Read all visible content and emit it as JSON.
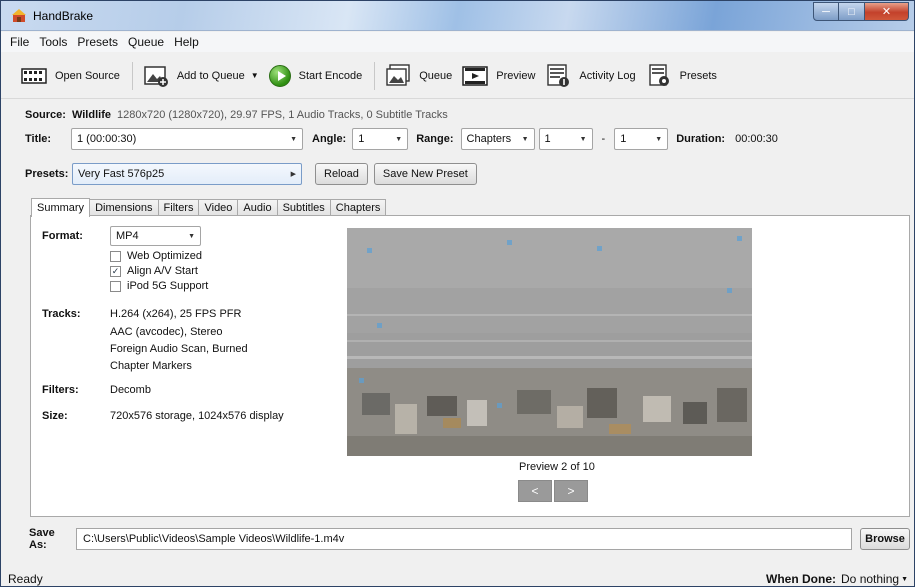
{
  "window": {
    "title": "HandBrake"
  },
  "menu": [
    "File",
    "Tools",
    "Presets",
    "Queue",
    "Help"
  ],
  "toolbar": {
    "open_source": "Open Source",
    "add_to_queue": "Add to Queue",
    "start_encode": "Start Encode",
    "queue": "Queue",
    "preview": "Preview",
    "activity_log": "Activity Log",
    "presets": "Presets"
  },
  "source": {
    "label": "Source:",
    "name": "Wildlife",
    "info": "1280x720 (1280x720), 29.97 FPS, 1 Audio Tracks, 0 Subtitle Tracks"
  },
  "title_row": {
    "title_label": "Title:",
    "title_value": "1 (00:00:30)",
    "angle_label": "Angle:",
    "angle_value": "1",
    "range_label": "Range:",
    "range_mode": "Chapters",
    "range_start": "1",
    "range_dash": "-",
    "range_end": "1",
    "duration_label": "Duration:",
    "duration_value": "00:00:30"
  },
  "presets_row": {
    "label": "Presets:",
    "value": "Very Fast 576p25",
    "reload": "Reload",
    "save_new": "Save New Preset"
  },
  "tabs": [
    "Summary",
    "Dimensions",
    "Filters",
    "Video",
    "Audio",
    "Subtitles",
    "Chapters"
  ],
  "summary": {
    "format_label": "Format:",
    "format_value": "MP4",
    "web_optimized": "Web Optimized",
    "align_av": "Align A/V Start",
    "ipod": "iPod 5G Support",
    "tracks_label": "Tracks:",
    "tracks": [
      "H.264 (x264), 25 FPS PFR",
      "AAC (avcodec), Stereo",
      "Foreign Audio Scan, Burned",
      "Chapter Markers"
    ],
    "filters_label": "Filters:",
    "filters_value": "Decomb",
    "size_label": "Size:",
    "size_value": "720x576 storage, 1024x576 display",
    "preview_caption": "Preview 2 of 10",
    "prev": "<",
    "next": ">"
  },
  "saveas": {
    "label": "Save As:",
    "path": "C:\\Users\\Public\\Videos\\Sample Videos\\Wildlife-1.m4v",
    "browse": "Browse"
  },
  "status": {
    "text": "Ready",
    "when_done_label": "When Done:",
    "when_done_value": "Do nothing"
  }
}
